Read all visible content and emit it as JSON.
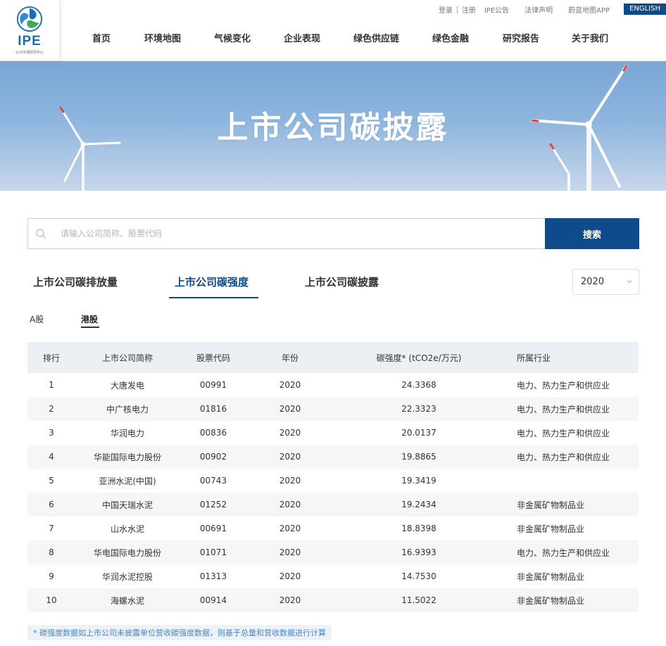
{
  "brand": {
    "logo_text": "IPE",
    "logo_sub": "公众环境研究中心"
  },
  "toplinks": {
    "login": "登录",
    "register": "注册",
    "notice": "IPE公告",
    "legal": "法律声明",
    "app": "蔚蓝地图APP",
    "lang": "ENGLISH"
  },
  "nav": [
    "首页",
    "环境地图",
    "气候变化",
    "企业表现",
    "绿色供应链",
    "绿色金融",
    "研究报告",
    "关于我们"
  ],
  "banner": {
    "title": "上市公司碳披露"
  },
  "search": {
    "placeholder": "请输入公司简称、股票代码",
    "value": "",
    "button": "搜索"
  },
  "tabs": [
    "上市公司碳排放量",
    "上市公司碳强度",
    "上市公司碳披露"
  ],
  "active_tab": 1,
  "year": {
    "selected": "2020"
  },
  "subtabs": [
    "A股",
    "港股"
  ],
  "active_subtab": 1,
  "table": {
    "headers": [
      "排行",
      "上市公司简称",
      "股票代码",
      "年份",
      "碳强度* (tCO2e/万元)",
      "所属行业"
    ],
    "rows": [
      [
        "1",
        "大唐发电",
        "00991",
        "2020",
        "24.3368",
        "电力、热力生产和供应业"
      ],
      [
        "2",
        "中广核电力",
        "01816",
        "2020",
        "22.3323",
        "电力、热力生产和供应业"
      ],
      [
        "3",
        "华润电力",
        "00836",
        "2020",
        "20.0137",
        "电力、热力生产和供应业"
      ],
      [
        "4",
        "华能国际电力股份",
        "00902",
        "2020",
        "19.8865",
        "电力、热力生产和供应业"
      ],
      [
        "5",
        "亚洲水泥(中国)",
        "00743",
        "2020",
        "19.3419",
        ""
      ],
      [
        "6",
        "中国天瑞水泥",
        "01252",
        "2020",
        "19.2434",
        "非金属矿物制品业"
      ],
      [
        "7",
        "山水水泥",
        "00691",
        "2020",
        "18.8398",
        "非金属矿物制品业"
      ],
      [
        "8",
        "华电国际电力股份",
        "01071",
        "2020",
        "16.9393",
        "电力、热力生产和供应业"
      ],
      [
        "9",
        "华润水泥控股",
        "01313",
        "2020",
        "14.7530",
        "非金属矿物制品业"
      ],
      [
        "10",
        "海螺水泥",
        "00914",
        "2020",
        "11.5022",
        "非金属矿物制品业"
      ]
    ]
  },
  "footnote": "* 碳强度数据如上市公司未披露单位营收碳强度数据，则基于总量和营收数据进行计算",
  "colors": {
    "primary": "#0f4a8a",
    "logo_blue": "#1a6fb0",
    "logo_green": "#3cab5a",
    "footnote_text": "#4a86c5"
  }
}
